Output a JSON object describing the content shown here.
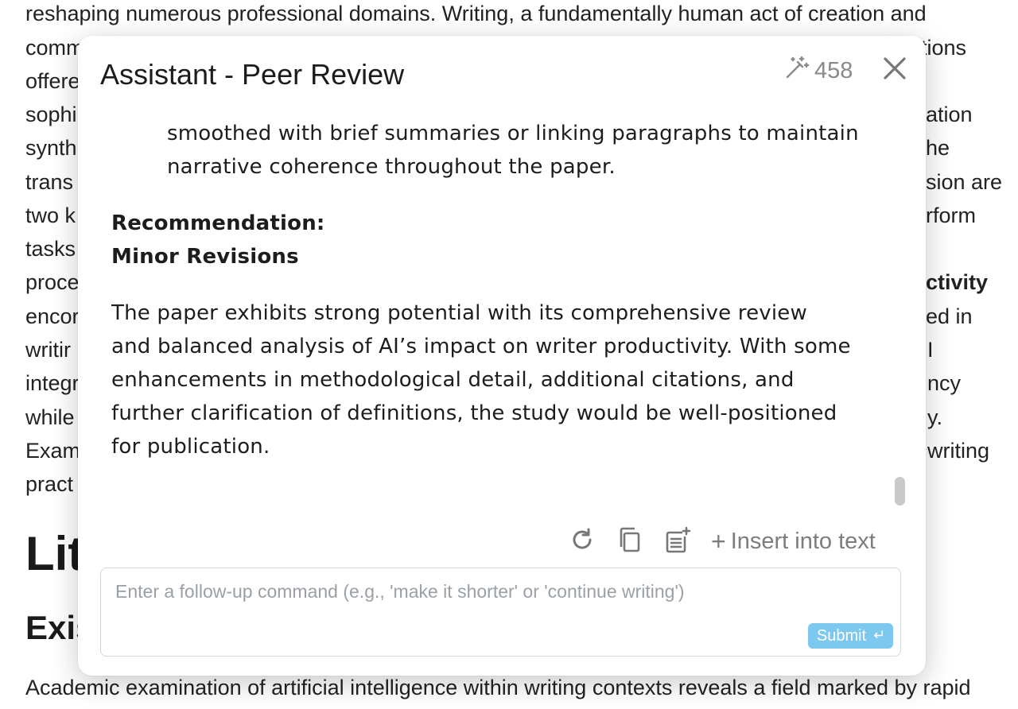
{
  "document": {
    "line1": "reshaping numerous professional domains. Writing, a fundamentally human act of creation and",
    "left_fragments": [
      "comm",
      "offere",
      "sophi",
      "synth",
      "trans",
      "two k",
      "tasks",
      "proce",
      "encor",
      "writir",
      "integr",
      "while",
      "Exam",
      "pract"
    ],
    "right_fragments": [
      {
        "text": "tions",
        "bold": false
      },
      {
        "text": "ation",
        "bold": false
      },
      {
        "text": "he",
        "bold": false
      },
      {
        "text": "sion are",
        "bold": false
      },
      {
        "text": "rform",
        "bold": false
      },
      {
        "text": "ctivity",
        "bold": true
      },
      {
        "text": "ed in",
        "bold": false
      },
      {
        "text": "I",
        "bold": false
      },
      {
        "text": "ncy",
        "bold": false
      },
      {
        "text": "y.",
        "bold": false
      },
      {
        "text": "writing",
        "bold": false
      }
    ],
    "heading1": "Lit",
    "heading2": "Exis",
    "last_line": "Academic examination of artificial intelligence within writing contexts reveals a field marked by rapid"
  },
  "modal": {
    "title": "Assistant - Peer Review",
    "credits": "458",
    "content": {
      "continued_text": "smoothed with brief summaries or linking paragraphs to maintain narrative coherence throughout the paper.",
      "recommendation_heading": "Recommendation:",
      "recommendation_value": "Minor Revisions",
      "summary": "The paper exhibits strong potential with its comprehensive review and balanced analysis of AI’s impact on writer productivity. With some enhancements in methodological detail, additional citations, and further clarification of definitions, the study would be well-positioned for publication."
    },
    "actions": {
      "insert_label": "Insert into text"
    },
    "followup": {
      "placeholder": "Enter a follow-up command (e.g., 'make it shorter' or 'continue writing')",
      "value": "",
      "submit_label": "Submit"
    }
  },
  "icons": {
    "credits": "magic-wand-icon",
    "close": "close-icon",
    "regenerate": "refresh-icon",
    "copy": "copy-icon",
    "append": "append-note-icon",
    "submit": "enter-key-icon"
  },
  "colors": {
    "submit_bg": "#7cc8ef",
    "muted_text": "#7d7d7d",
    "placeholder": "#9aa0a6"
  }
}
